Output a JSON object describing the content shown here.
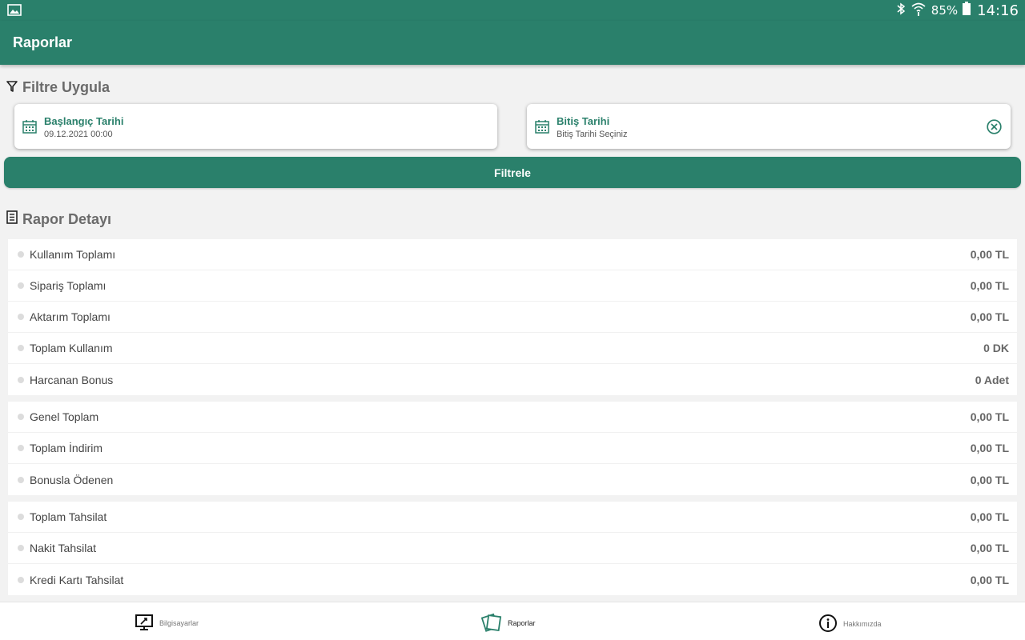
{
  "status_bar": {
    "battery": "85%",
    "time": "14:16"
  },
  "app_bar": {
    "title": "Raporlar"
  },
  "filter": {
    "title": "Filtre Uygula",
    "start_date": {
      "label": "Başlangıç Tarihi",
      "value": "09.12.2021 00:00"
    },
    "end_date": {
      "label": "Bitiş Tarihi",
      "placeholder": "Bitiş Tarihi Seçiniz"
    },
    "button_label": "Filtrele"
  },
  "report": {
    "title": "Rapor Detayı",
    "groups": [
      [
        {
          "name": "Kullanım Toplamı",
          "value": "0,00 TL"
        },
        {
          "name": "Sipariş Toplamı",
          "value": "0,00 TL"
        },
        {
          "name": "Aktarım Toplamı",
          "value": "0,00 TL"
        },
        {
          "name": "Toplam Kullanım",
          "value": "0 DK"
        },
        {
          "name": "Harcanan Bonus",
          "value": "0 Adet"
        }
      ],
      [
        {
          "name": "Genel Toplam",
          "value": "0,00 TL"
        },
        {
          "name": "Toplam İndirim",
          "value": "0,00 TL"
        },
        {
          "name": "Bonusla Ödenen",
          "value": "0,00 TL"
        }
      ],
      [
        {
          "name": "Toplam Tahsilat",
          "value": "0,00 TL"
        },
        {
          "name": "Nakit Tahsilat",
          "value": "0,00 TL"
        },
        {
          "name": "Kredi Kartı Tahsilat",
          "value": "0,00 TL"
        }
      ]
    ]
  },
  "bottom_nav": {
    "items": [
      {
        "label": "Bilgisayarlar",
        "icon": "computer-icon"
      },
      {
        "label": "Raporlar",
        "icon": "reports-icon"
      },
      {
        "label": "Hakkımızda",
        "icon": "info-icon"
      }
    ]
  },
  "colors": {
    "primary": "#2a806b",
    "background": "#f2f2f2"
  }
}
